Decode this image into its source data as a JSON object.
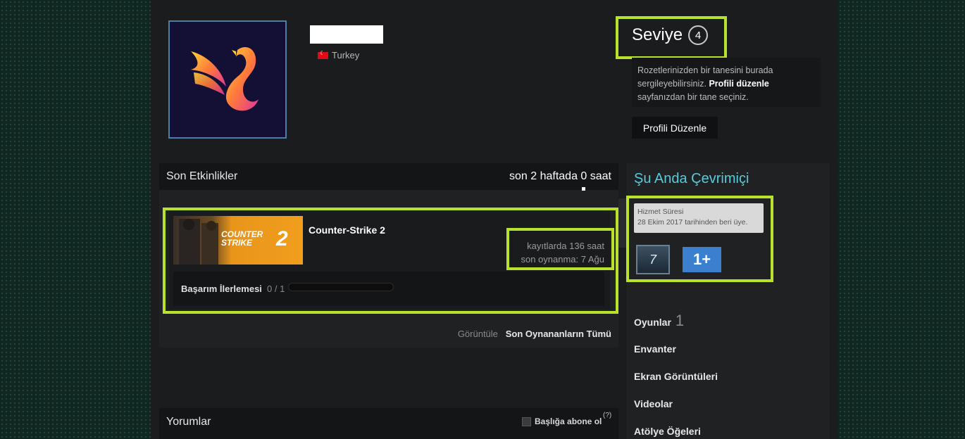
{
  "profile": {
    "country": "Turkey"
  },
  "level": {
    "label": "Seviye",
    "value": "4"
  },
  "badge_hint": {
    "text_before": "Rozetlerinizden bir tanesini burada sergileyebilirsiniz. ",
    "link": "Profili düzenle",
    "text_after": " sayfanızdan bir tane seçiniz."
  },
  "edit_profile_label": "Profili Düzenle",
  "activity": {
    "title": "Son Etkinlikler",
    "summary": "son 2 haftada 0 saat",
    "game": {
      "name": "Counter-Strike 2",
      "logo_line1": "COUNTER",
      "logo_line2": "STRIKE",
      "logo_num": "2",
      "hours": "kayıtlarda 136 saat",
      "last_played": "son oynanma: 7 Ağu",
      "achievement_label": "Başarım İlerlemesi",
      "achievement_value": "0 / 1",
      "achievement_progress": 0
    },
    "view_label": "Görüntüle",
    "view_link": "Son Oynananların Tümü"
  },
  "comments": {
    "title": "Yorumlar",
    "subscribe": "Başlığa abone ol",
    "help": "(?)"
  },
  "sidebar": {
    "status": "Şu Anda Çevrimiçi",
    "service_title": "Hizmet Süresi",
    "service_text": "28 Ekim 2017 tarihinden beri üye.",
    "badge_years": "7",
    "badge_games": "1+",
    "nav": [
      {
        "label": "Oyunlar",
        "count": "1"
      },
      {
        "label": "Envanter"
      },
      {
        "label": "Ekran Görüntüleri"
      },
      {
        "label": "Videolar"
      },
      {
        "label": "Atölye Öğeleri"
      }
    ]
  },
  "colors": {
    "highlight": "#b8e22c",
    "online": "#57cbde"
  }
}
